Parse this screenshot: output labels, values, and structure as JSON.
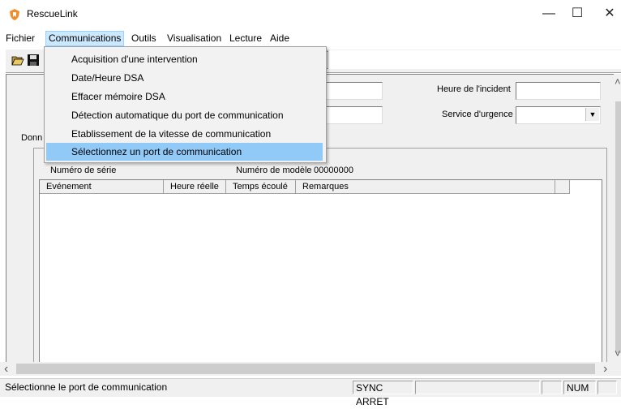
{
  "window": {
    "title": "RescueLink",
    "controls": {
      "minimize": "—",
      "maximize": "☐",
      "close": "✕"
    }
  },
  "menubar": {
    "items": [
      "Fichier",
      "Communications",
      "Outils",
      "Visualisation",
      "Lecture",
      "Aide"
    ],
    "active": "Communications"
  },
  "communications_menu": {
    "items": [
      "Acquisition d'une intervention",
      "Date/Heure DSA",
      "Effacer mémoire DSA",
      "Détection automatique du port de communication",
      "Etablissement de la vitesse de communication",
      "Sélectionnez un port de communication"
    ],
    "highlighted": "Sélectionnez un port de communication"
  },
  "form": {
    "incident_time_label": "Heure de l'incident",
    "emergency_service_label": "Service d'urgence",
    "tab_label_partial": "Donn",
    "serial_label": "Numéro de série",
    "model_label": "Numéro de modèle",
    "model_value": "00000000"
  },
  "event_table": {
    "columns": [
      "Evénement",
      "Heure réelle",
      "Temps écoulé",
      "Remarques"
    ],
    "rows": []
  },
  "scrollbars": {
    "left_arrow": "‹",
    "right_arrow": "›",
    "up_arrow": "˄",
    "down_arrow": "˅"
  },
  "statusbar": {
    "message": "Sélectionne le port de communication",
    "sync": "SYNC ARRET",
    "num": "NUM"
  },
  "icons": {
    "app": "rescuelink-logo-icon",
    "open": "open-folder-icon",
    "save": "save-disk-icon"
  },
  "colors": {
    "menu_highlight": "#91c9f7",
    "active_menu_bg": "#cce8ff",
    "app_logo": "#f28c28"
  }
}
